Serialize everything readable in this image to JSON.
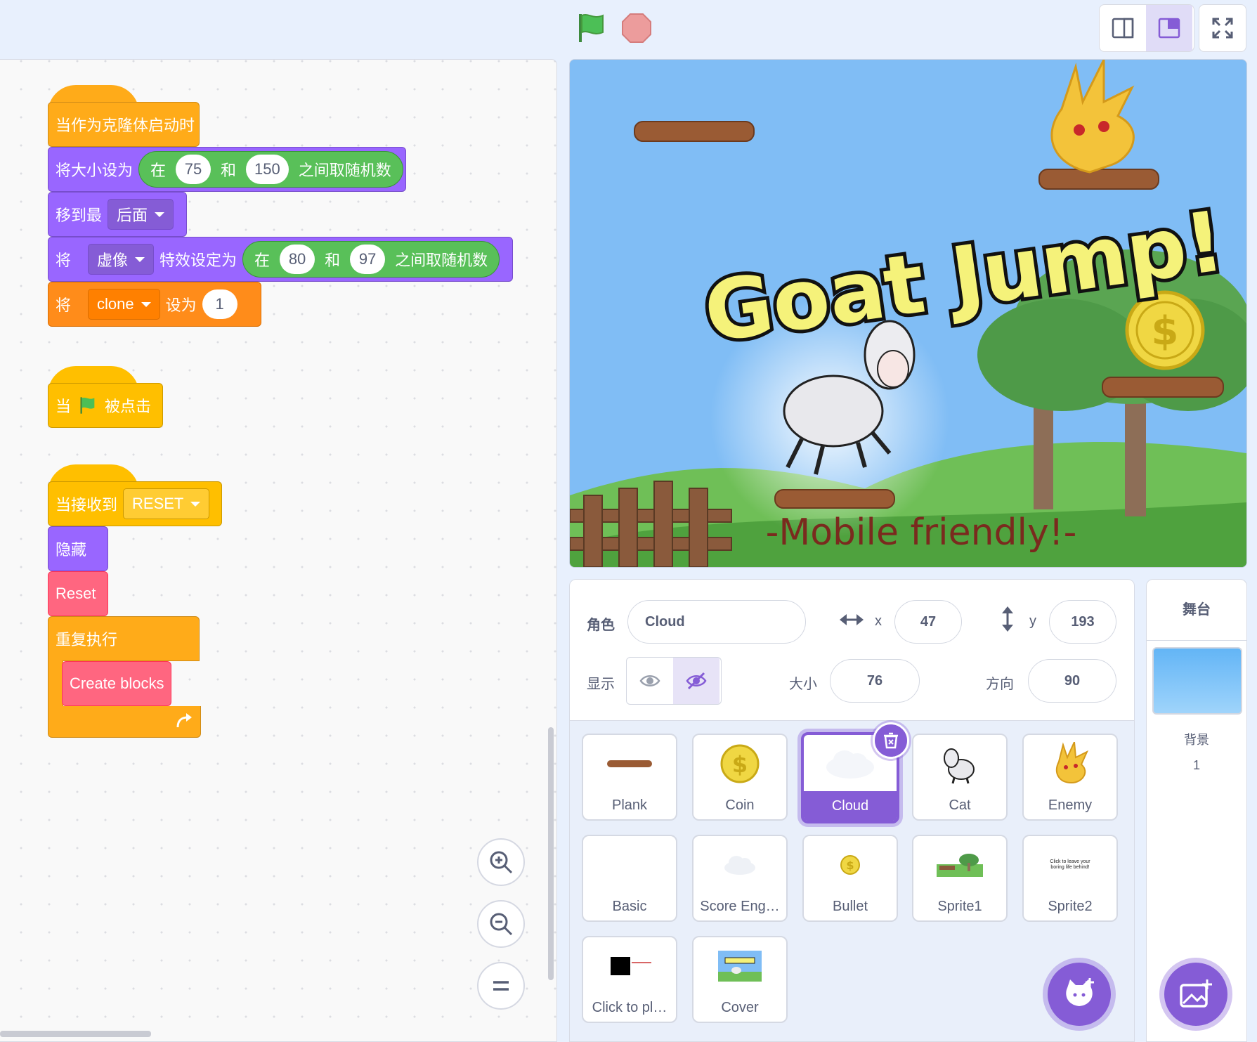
{
  "colors": {
    "looks": "#9966ff",
    "control": "#ffab19",
    "events": "#ffbf00",
    "variables": "#ff8c1a",
    "myblocks": "#ff6680",
    "operators": "#59c059",
    "accent": "#855cd6"
  },
  "topbar": {
    "flag_icon": "green-flag-icon",
    "stop_icon": "stop-icon",
    "small_stage_icon": "small-stage-icon",
    "large_stage_icon": "large-stage-icon",
    "fullscreen_icon": "fullscreen-icon"
  },
  "scripts": {
    "clone_hat": "当作为克隆体启动时",
    "size_block": {
      "label": "将大小设为",
      "op_in": "在",
      "a": "75",
      "op_and": "和",
      "b": "150",
      "op_tail": "之间取随机数"
    },
    "layer_block": {
      "label": "移到最",
      "value": "后面"
    },
    "effect_block": {
      "label": "将",
      "effect": "虚像",
      "mid": "特效设定为",
      "op_in": "在",
      "a": "80",
      "op_and": "和",
      "b": "97",
      "op_tail": "之间取随机数"
    },
    "var_block": {
      "label": "将",
      "var": "clone",
      "mid": "设为",
      "value": "1"
    },
    "flag_hat": {
      "pre": "当",
      "post": "被点击"
    },
    "receive_hat": {
      "label": "当接收到",
      "message": "RESET"
    },
    "hide_block": "隐藏",
    "reset_block": "Reset",
    "forever_block": "重复执行",
    "create_block": "Create blocks"
  },
  "stage": {
    "title": "Goat Jump!",
    "subtitle": "-Mobile friendly!-"
  },
  "sprite_info": {
    "sprite_label": "角色",
    "sprite_name": "Cloud",
    "x_label": "x",
    "x": "47",
    "y_label": "y",
    "y": "193",
    "show_label": "显示",
    "size_label": "大小",
    "size": "76",
    "direction_label": "方向",
    "direction": "90"
  },
  "sprites": [
    {
      "name": "Plank"
    },
    {
      "name": "Coin"
    },
    {
      "name": "Cloud",
      "selected": true
    },
    {
      "name": "Cat"
    },
    {
      "name": "Enemy"
    },
    {
      "name": "Basic"
    },
    {
      "name": "Score Eng…"
    },
    {
      "name": "Bullet"
    },
    {
      "name": "Sprite1"
    },
    {
      "name": "Sprite2"
    },
    {
      "name": "Click to pl…"
    },
    {
      "name": "Cover"
    }
  ],
  "sprite2_thumb_text": "Click to leave your boring life behind!",
  "stage_panel": {
    "title": "舞台",
    "backdrop_label": "背景",
    "backdrop_count": "1"
  }
}
